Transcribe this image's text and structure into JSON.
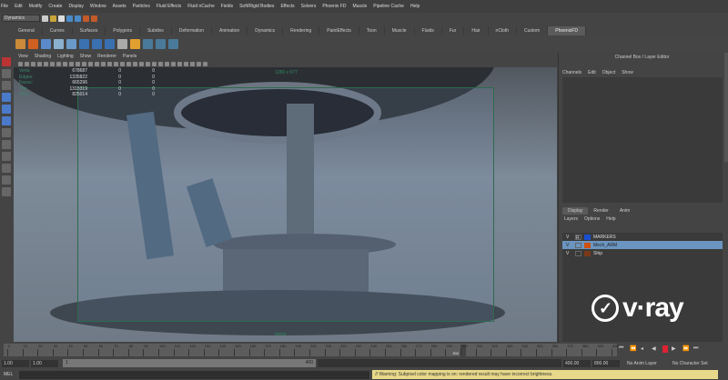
{
  "menu": [
    "File",
    "Edit",
    "Modify",
    "Create",
    "Display",
    "Window",
    "Assets",
    "Particles",
    "Fluid Effects",
    "Fluid nCache",
    "Fields",
    "Soft/Rigid Bodies",
    "Effects",
    "Solvers",
    "Phoenix FD",
    "Muscle",
    "Pipeline Cache",
    "Help"
  ],
  "status": {
    "mode": "Dynamics"
  },
  "shelf_tabs": [
    "General",
    "Curves",
    "Surfaces",
    "Polygons",
    "Subdivs",
    "Deformation",
    "Animation",
    "Dynamics",
    "Rendering",
    "PaintEffects",
    "Toon",
    "Muscle",
    "Fluids",
    "Fur",
    "Hair",
    "nCloth",
    "Custom",
    "PhoenixFD"
  ],
  "shelf_active": "PhoenixFD",
  "viewport": {
    "menu": [
      "View",
      "Shading",
      "Lighting",
      "Show",
      "Renderer",
      "Panels"
    ],
    "resolution": "1280 x 677",
    "camera": "persp",
    "hud": [
      {
        "label": "Verts:",
        "value": "678687",
        "a": "0",
        "b": "0"
      },
      {
        "label": "Edges:",
        "value": "1335822",
        "a": "0",
        "b": "0"
      },
      {
        "label": "Faces:",
        "value": "665296",
        "a": "0",
        "b": "0"
      },
      {
        "label": "Tris:",
        "value": "1315319",
        "a": "0",
        "b": "0"
      },
      {
        "label": "UVs:",
        "value": "825014",
        "a": "0",
        "b": "0"
      }
    ]
  },
  "channel_box": {
    "title": "Channel Box / Layer Editor",
    "menu": [
      "Channels",
      "Edit",
      "Object",
      "Show"
    ]
  },
  "layer_editor": {
    "tabs": [
      "Display",
      "Render",
      "Anim"
    ],
    "menu": [
      "Layers",
      "Options",
      "Help"
    ],
    "layers": [
      {
        "v": "V",
        "r": "R",
        "color": "#1a4fd0",
        "name": "MARKERS",
        "selected": false
      },
      {
        "v": "V",
        "r": "",
        "color": "#d05010",
        "name": "Mech_ARM",
        "selected": true
      },
      {
        "v": "V",
        "r": "",
        "color": "#7a3a1a",
        "name": "Ship",
        "selected": false
      }
    ]
  },
  "logo": {
    "text": "v·ray"
  },
  "timeline": {
    "start": 0,
    "end": 400,
    "step": 10,
    "current": 302,
    "current_label": "302"
  },
  "range": {
    "start": "1.00",
    "start2": "1.00",
    "slider_min": "1",
    "slider_max": "400",
    "end": "400.00",
    "end2": "800.00",
    "anim_layer": "No Anim Layer",
    "char_set": "No Character Set"
  },
  "command": {
    "label": "MEL",
    "warning": "// Warning: Subpixel color mapping is on: rendered result may have incorrect brightness."
  }
}
